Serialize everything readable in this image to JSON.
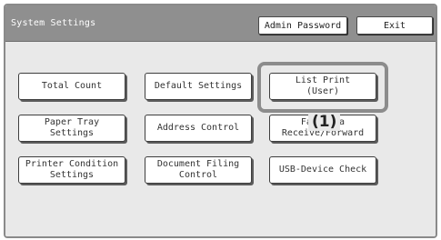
{
  "header": {
    "title": "System Settings",
    "admin_password_label": "Admin Password",
    "exit_label": "Exit"
  },
  "buttons": {
    "total_count": "Total Count",
    "default_settings": "Default Settings",
    "list_print_line1": "List Print",
    "list_print_line2": "(User)",
    "paper_tray_line1": "Paper Tray",
    "paper_tray_line2": "Settings",
    "address_control": "Address Control",
    "receive_forward_line1": "Fax Data",
    "receive_forward_line2": "Receive/Forward",
    "printer_condition_line1": "Printer Condition",
    "printer_condition_line2": "Settings",
    "document_filing_line1": "Document Filing",
    "document_filing_line2": "Control",
    "usb_device_check": "USB-Device Check"
  },
  "callout": {
    "label": "(1)"
  },
  "colors": {
    "titlebar": "#8f8f8f",
    "content_background": "#e9e9e9",
    "highlight_border": "#8c8c8c"
  }
}
